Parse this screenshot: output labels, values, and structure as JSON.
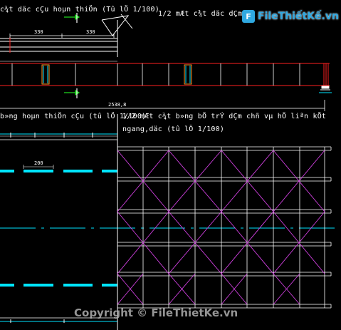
{
  "drawing": {
    "title_left": "c¾t däc cÇu hoµn thiÖn (Tû lÖ 1/100)",
    "title_right": "1/2 mÆt c¾t däc dÇm",
    "title_plan": "b»ng hoµn thiÖn cÇu (tû lÖ 1/100)",
    "title_bracing_line1": "1/2 mÆt c¾t b»ng bÖ trÝ dÇm chñ vµ hÖ liªn kÕt",
    "title_bracing_line2": "ngang,däc (tû lÖ 1/100)",
    "dim_330_a": "330",
    "dim_330_b": "330",
    "dim_2538": "2538,8",
    "dim_200": "200"
  },
  "watermark": {
    "logo_mark": "F",
    "logo_text": "FileThiếtKế.vn",
    "copyright": "Copyright © FileThietKe.vn"
  },
  "colors": {
    "background": "#000000",
    "line_white": "#ffffff",
    "elevation_red": "#ff2020",
    "lane_cyan": "#00e5ff",
    "bracing_magenta": "#d040e0",
    "arrow_green": "#20e020",
    "logo_blue": "#2fa8e0"
  }
}
